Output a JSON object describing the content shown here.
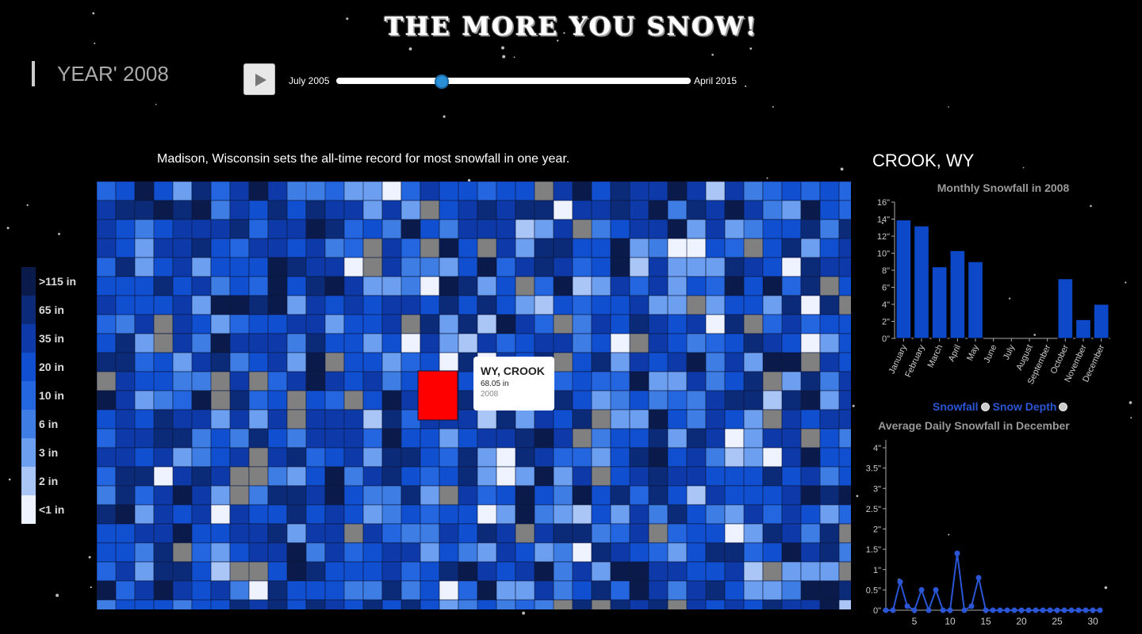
{
  "app_title": "THE MORE YOU SNOW!",
  "year_label": "YEAR' 2008",
  "timeline": {
    "start_label": "July 2005",
    "end_label": "April 2015",
    "position": 0.3
  },
  "annotation": "Madison, Wisconsin sets the all-time record for most snowfall in one year.",
  "tooltip": {
    "title": "WY, CROOK",
    "value": "68.05 in",
    "year": "2008"
  },
  "legend": {
    "labels": [
      ">115 in",
      "65 in",
      "35 in",
      "20 in",
      "10 in",
      "6 in",
      "3 in",
      "2 in",
      "<1 in"
    ],
    "colors": [
      "#0a1a4a",
      "#0b2a78",
      "#0d3aa8",
      "#0f4fd0",
      "#2466e0",
      "#3d7de4",
      "#6d9ff0",
      "#a9c6f6",
      "#eef3ff"
    ]
  },
  "selected_county": "CROOK, WY",
  "colors": {
    "no_data": "#808080",
    "selected": "#ff0000",
    "accent": "#2a56d6",
    "bar": "#0d48c8"
  },
  "toggles": {
    "snowfall": "Snowfall",
    "snow_depth": "Snow Depth"
  },
  "chart_data": [
    {
      "type": "bar",
      "title": "Monthly Snowfall in 2008",
      "categories": [
        "January",
        "February",
        "March",
        "April",
        "May",
        "June",
        "July",
        "August",
        "September",
        "October",
        "November",
        "December"
      ],
      "values": [
        13.9,
        13.2,
        8.4,
        10.3,
        9.0,
        0,
        0,
        0,
        0,
        7.0,
        2.2,
        4.0
      ],
      "yticks": [
        "0\"",
        "2\"",
        "4\"",
        "6\"",
        "8\"",
        "10\"",
        "12\"",
        "14\"",
        "16\""
      ],
      "ylim": [
        0,
        16
      ]
    },
    {
      "type": "line",
      "title": "Average Daily Snowfall in December",
      "x": [
        1,
        2,
        3,
        4,
        5,
        6,
        7,
        8,
        9,
        10,
        11,
        12,
        13,
        14,
        15,
        16,
        17,
        18,
        19,
        20,
        21,
        22,
        23,
        24,
        25,
        26,
        27,
        28,
        29,
        30,
        31
      ],
      "y": [
        0,
        0,
        0.7,
        0.1,
        0,
        0.5,
        0,
        0.5,
        0,
        0,
        1.4,
        0,
        0.1,
        0.8,
        0,
        0,
        0,
        0,
        0,
        0,
        0,
        0,
        0,
        0,
        0,
        0,
        0,
        0,
        0,
        0,
        0
      ],
      "xticks": [
        "5",
        "10",
        "15",
        "20",
        "25",
        "30"
      ],
      "yticks": [
        "0\"",
        "0.5\"",
        "1\"",
        "1.5\"",
        "2\"",
        "2.5\"",
        "3\"",
        "3.5\"",
        "4\""
      ],
      "ylim": [
        0,
        4
      ]
    }
  ]
}
